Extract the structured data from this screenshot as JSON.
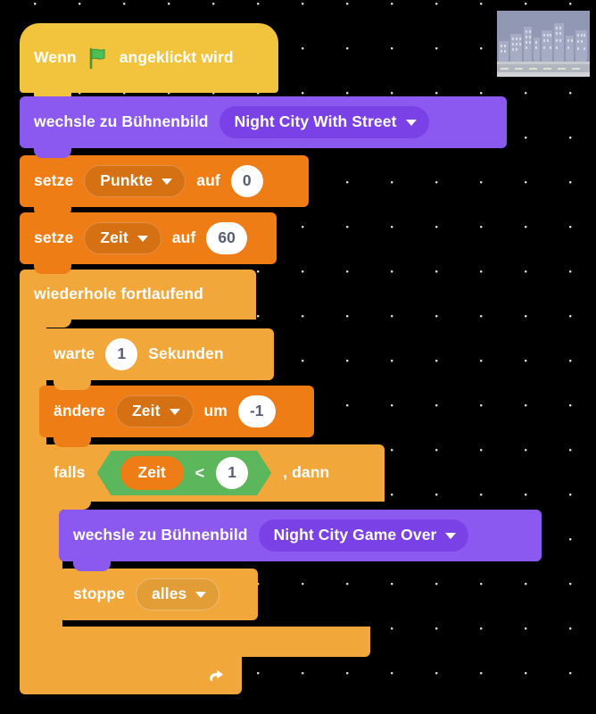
{
  "workspace": {
    "background_color": "#000000",
    "dot_color": "#ffffff",
    "dot_spacing_px": 50
  },
  "stage_thumbnail": {
    "name": "stage-backdrop-thumbnail",
    "description": "Night City With Street backdrop preview"
  },
  "colors": {
    "events_yellow": "#f2c33c",
    "looks_purple": "#8b58f0",
    "looks_purple_dark": "#7a41e6",
    "variables_orange": "#ee7d16",
    "control_orange": "#f2a73b",
    "operators_green": "#5cb65c",
    "input_white": "#ffffff",
    "input_text": "#575e75"
  },
  "script": {
    "hat": {
      "label_before": "Wenn",
      "icon": "green-flag-icon",
      "label_after": "angeklickt wird"
    },
    "switch_backdrop_1": {
      "label": "wechsle zu Bühnenbild",
      "dropdown_value": "Night City With Street"
    },
    "set_points": {
      "label": "setze",
      "variable": "Punkte",
      "middle_label": "auf",
      "value": "0"
    },
    "set_time": {
      "label": "setze",
      "variable": "Zeit",
      "middle_label": "auf",
      "value": "60"
    },
    "forever": {
      "label": "wiederhole fortlaufend",
      "icon": "loop-arrow-icon"
    },
    "wait": {
      "label": "warte",
      "value": "1",
      "unit_label": "Sekunden"
    },
    "change_time": {
      "label": "ändere",
      "variable": "Zeit",
      "middle_label": "um",
      "value": "-1"
    },
    "if_then": {
      "label": "falls",
      "condition": {
        "left_variable": "Zeit",
        "operator": "<",
        "right_value": "1"
      },
      "label_end": ", dann"
    },
    "switch_backdrop_2": {
      "label": "wechsle zu Bühnenbild",
      "dropdown_value": "Night City Game Over"
    },
    "stop": {
      "label": "stoppe",
      "dropdown_value": "alles"
    }
  }
}
